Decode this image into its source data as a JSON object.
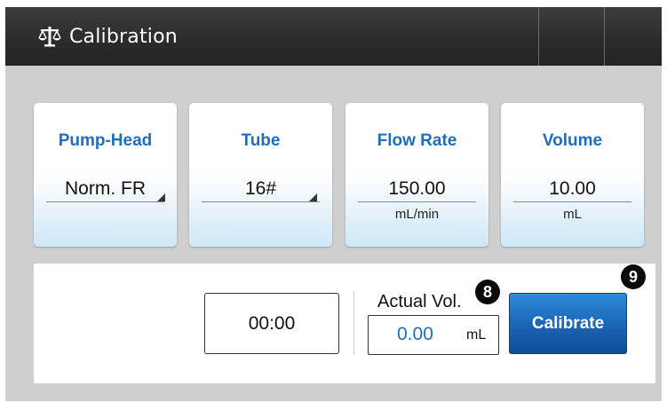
{
  "header": {
    "title": "Calibration",
    "icon": "balance-scale-icon"
  },
  "cards": [
    {
      "title": "Pump-Head",
      "value": "Norm. FR",
      "unit": "",
      "dropdown": true
    },
    {
      "title": "Tube",
      "value": "16#",
      "unit": "",
      "dropdown": true
    },
    {
      "title": "Flow Rate",
      "value": "150.00",
      "unit": "mL/min",
      "dropdown": false
    },
    {
      "title": "Volume",
      "value": "10.00",
      "unit": "mL",
      "dropdown": false
    }
  ],
  "panel": {
    "timer": "00:00",
    "actual_label": "Actual Vol.",
    "actual_value": "0.00",
    "actual_unit": "mL",
    "calibrate_label": "Calibrate"
  },
  "badges": {
    "actual": "8",
    "calibrate": "9"
  },
  "colors": {
    "header_bg": "#2b2c2e",
    "accent_blue": "#1e6ec0",
    "button_blue": "#1a64b4",
    "body_bg": "#cfcfcf"
  }
}
